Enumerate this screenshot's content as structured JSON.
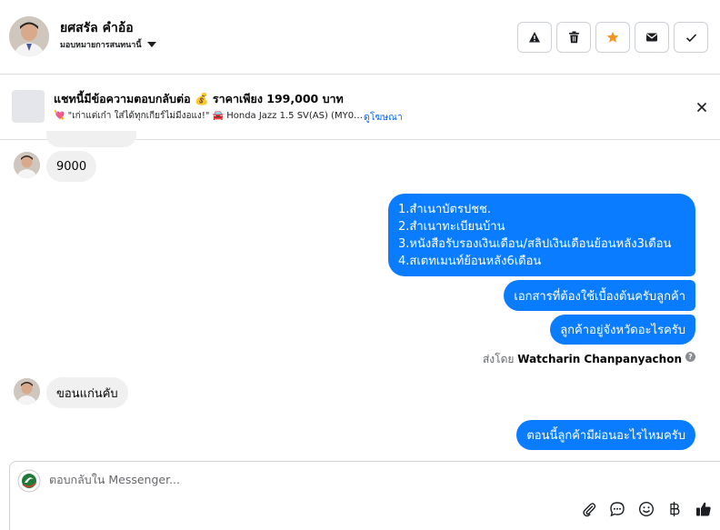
{
  "header": {
    "contact_name": "ยศสรัล คำอ้อ",
    "assign_label": "มอบหมายการสนทนานี้",
    "actions": [
      "report-icon",
      "trash-icon",
      "star-icon",
      "envelope-icon",
      "check-icon"
    ],
    "star_color": "#f7931e"
  },
  "ad": {
    "title": "แชทนี้มีข้อความตอบกลับต่อ 💰 ราคาเพียง 199,000 บาท",
    "subtitle": "💘 \"เก่าแต่เก๋า ใส่ได้ทุกเกียร์ไม่มีงอแง!\" 🚘 Honda Jazz 1.5 SV(AS) (MY0…",
    "link": "ดูโฆษณา"
  },
  "messages": {
    "in_1": "9000",
    "out_list": [
      "1.สำเนาบัตรปชช.",
      "2.สำเนาทะเบียนบ้าน",
      "3.หนังสือรับรองเงินเดือน/สลิปเงินเดือนย้อนหลัง3เดือน",
      "4.สเตทเมนท์ย้อนหลัง6เดือน"
    ],
    "out_2": "เอกสารที่ต้องใช้เบื้องต้นครับลูกค้า",
    "out_3": "ลูกค้าอยู่จังหวัดอะไรครับ",
    "sent_by_prefix": "ส่งโดย",
    "sent_by_name": "Watcharin Chanpanyachon",
    "in_2": "ขอนแก่นคับ",
    "out_4": "ตอนนี้ลูกค้ามีผ่อนอะไรไหมครับ"
  },
  "composer": {
    "placeholder": "ตอบกลับใน Messenger...",
    "tools": [
      "paperclip-icon",
      "chat-bubble-icon",
      "emoji-icon",
      "baht-icon",
      "thumbs-up-icon"
    ]
  },
  "colors": {
    "outgoing_bubble": "#0a7cff",
    "incoming_bubble": "#f0f0f0",
    "link": "#0866ff"
  }
}
